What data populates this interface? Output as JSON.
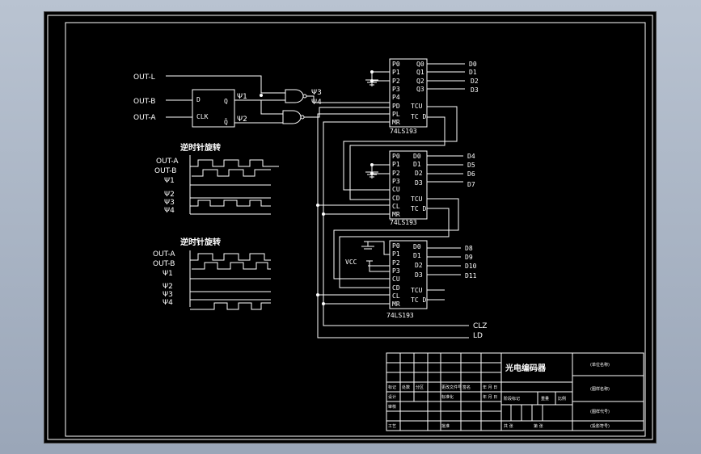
{
  "title": "光电编码器",
  "inputs": [
    "OUT-L",
    "OUT-B",
    "OUT-A"
  ],
  "flipflop": {
    "d": "D",
    "clk": "CLK",
    "q": "Q",
    "qbar": "Q̄"
  },
  "signals": {
    "phi1": "Ψ1",
    "phi2": "Ψ2",
    "phi3": "Ψ3",
    "phi4": "Ψ4"
  },
  "counter1": {
    "label": "74LS193",
    "left": [
      "P0",
      "P1",
      "P2",
      "P3",
      "P4",
      "PD",
      "PL",
      "MR"
    ],
    "right": [
      "Q0",
      "Q1",
      "Q2",
      "Q3",
      "TCU",
      "TC D"
    ],
    "outs": [
      "D0",
      "D1",
      "D2",
      "D3"
    ]
  },
  "counter2": {
    "label": "74LS193",
    "left": [
      "P0",
      "P1",
      "P2",
      "P3",
      "CU",
      "CD",
      "CL",
      "MR"
    ],
    "right": [
      "D0",
      "D1",
      "D2",
      "D3",
      "TCU",
      "TC D"
    ],
    "outs": [
      "D4",
      "D5",
      "D6",
      "D7"
    ]
  },
  "counter3": {
    "label": "74LS193",
    "left": [
      "P0",
      "P1",
      "P2",
      "P3",
      "CU",
      "CD",
      "CL",
      "MR"
    ],
    "right": [
      "D0",
      "D1",
      "D2",
      "D3",
      "TCU",
      "TC D"
    ],
    "outs": [
      "D8",
      "D9",
      "D10",
      "D11"
    ]
  },
  "vcc": "VCC",
  "bus": [
    "CLZ",
    "LD"
  ],
  "timing": [
    {
      "title": "逆时针旋转",
      "labels": [
        "OUT-A",
        "OUT-B",
        "Ψ1",
        "Ψ2",
        "Ψ3",
        "Ψ4"
      ]
    },
    {
      "title": "逆时针旋转",
      "labels": [
        "OUT-A",
        "OUT-B",
        "Ψ1",
        "Ψ2",
        "Ψ3",
        "Ψ4"
      ]
    }
  ],
  "titleblock": {
    "row_labels": [
      "标记",
      "设计",
      "审核",
      "工艺"
    ],
    "cells": [
      "处数",
      "分区",
      "更改文件号",
      "签名",
      "年 月 日",
      "标准化",
      "年 月 日",
      "批准",
      "阶段标记",
      "重量",
      "比例",
      "共 张",
      "第 张"
    ],
    "right": [
      "(单位名称)",
      "(图样名称)",
      "(图样代号)",
      "(投影符号)"
    ]
  }
}
